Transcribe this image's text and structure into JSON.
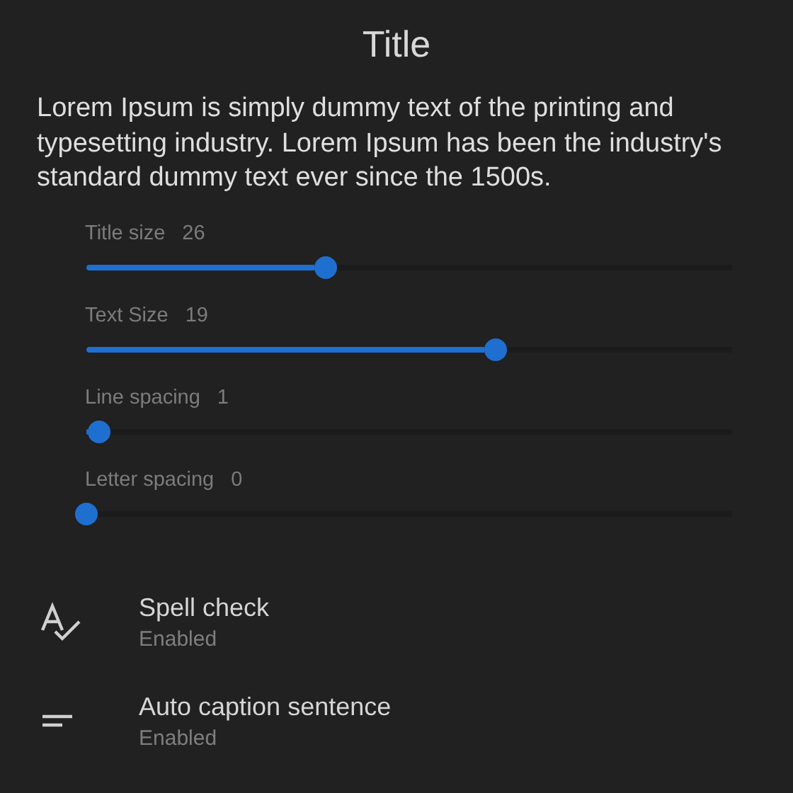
{
  "title": "Title",
  "body": "Lorem Ipsum is simply dummy text of the printing and typesetting industry. Lorem Ipsum has been the industry's standard dummy text ever since the 1500s.",
  "sliders": [
    {
      "label": "Title size",
      "reading": "26",
      "level": 0.37
    },
    {
      "label": "Text Size",
      "reading": "19",
      "level": 0.634
    },
    {
      "label": "Line spacing",
      "reading": "1",
      "level": 0.02
    },
    {
      "label": "Letter spacing",
      "reading": "0",
      "level": 0
    }
  ],
  "settings": [
    {
      "kind": "spellcheck",
      "title": "Spell check",
      "status": "Enabled"
    },
    {
      "kind": "caption",
      "title": "Auto caption sentence",
      "status": "Enabled"
    }
  ]
}
